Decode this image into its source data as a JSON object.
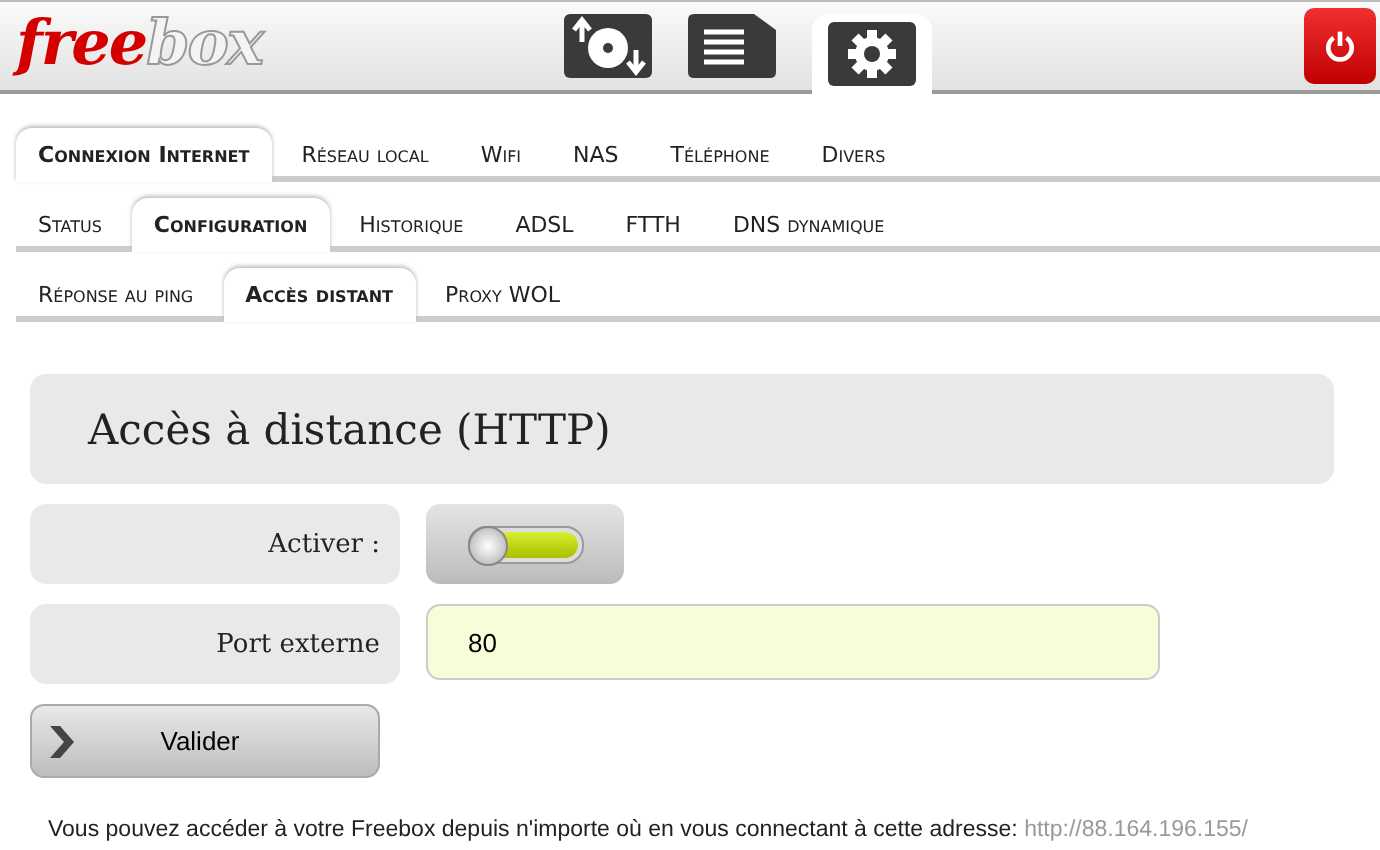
{
  "logo": {
    "first": "free",
    "second": "box"
  },
  "nav": [
    {
      "kind": "disk",
      "selected": false
    },
    {
      "kind": "list",
      "selected": false
    },
    {
      "kind": "gear",
      "selected": true
    }
  ],
  "tabs_main": [
    {
      "label": "Connexion Internet",
      "selected": true
    },
    {
      "label": "Réseau local",
      "selected": false
    },
    {
      "label": "Wifi",
      "selected": false
    },
    {
      "label": "NAS",
      "selected": false
    },
    {
      "label": "Téléphone",
      "selected": false
    },
    {
      "label": "Divers",
      "selected": false
    }
  ],
  "tabs_sub": [
    {
      "label": "Status",
      "selected": false
    },
    {
      "label": "Configuration",
      "selected": true
    },
    {
      "label": "Historique",
      "selected": false
    },
    {
      "label": "ADSL",
      "selected": false
    },
    {
      "label": "FTTH",
      "selected": false
    },
    {
      "label": "DNS dynamique",
      "selected": false
    }
  ],
  "tabs_third": [
    {
      "label": "Réponse au ping",
      "selected": false
    },
    {
      "label": "Accès distant",
      "selected": true
    },
    {
      "label": "Proxy WOL",
      "selected": false
    }
  ],
  "heading": "Accès à distance (HTTP)",
  "activate": {
    "label": "Activer :",
    "on": true
  },
  "port": {
    "label": "Port externe",
    "value": "80"
  },
  "submit": "Valider",
  "footer": {
    "text": "Vous pouvez accéder à votre Freebox depuis n'importe où en vous connectant à cette adresse:",
    "link": "http://88.164.196.155/"
  }
}
